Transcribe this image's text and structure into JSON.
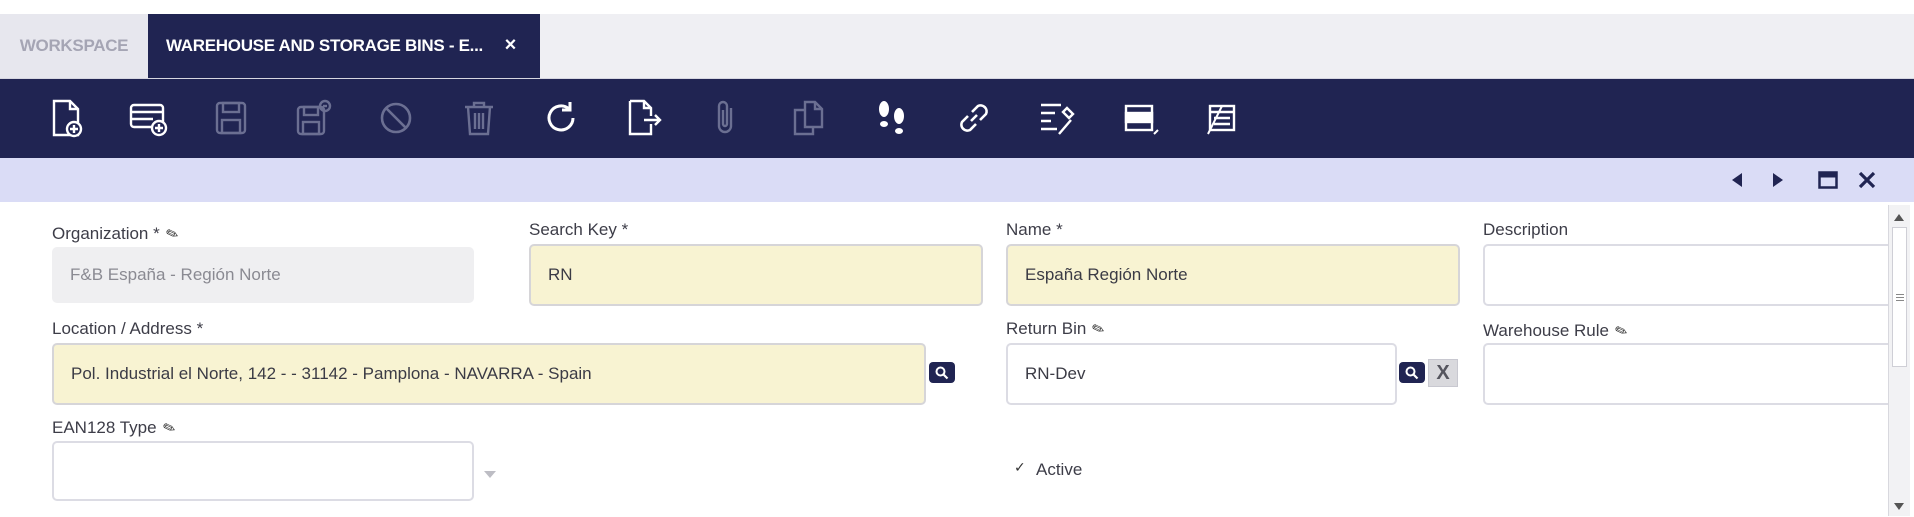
{
  "tabs": {
    "workspace": "WORKSPACE",
    "active": "WAREHOUSE AND STORAGE BINS - E...",
    "close_glyph": "×"
  },
  "toolbar": {
    "icons": [
      "new-document-icon",
      "new-row-icon",
      "save-icon",
      "save-close-icon",
      "undo-icon",
      "delete-icon",
      "refresh-icon",
      "export-icon",
      "attachment-icon",
      "copy-record-icon",
      "audit-trail-icon",
      "link-icon",
      "process-icon",
      "form-grid-toggle-icon",
      "notes-icon"
    ]
  },
  "nav": {
    "icons": [
      "previous-record-icon",
      "next-record-icon",
      "maximize-icon",
      "close-icon"
    ]
  },
  "form": {
    "organization": {
      "label": "Organization *",
      "value": "F&B España - Región Norte"
    },
    "search_key": {
      "label": "Search Key *",
      "value": "RN"
    },
    "name": {
      "label": "Name *",
      "value": "España Región Norte"
    },
    "description": {
      "label": "Description",
      "value": ""
    },
    "location": {
      "label": "Location / Address *",
      "value": "Pol. Industrial el Norte, 142 - - 31142 - Pamplona - NAVARRA - Spain"
    },
    "return_bin": {
      "label": "Return Bin",
      "value": "RN-Dev",
      "clear_glyph": "X"
    },
    "warehouse_rule": {
      "label": "Warehouse Rule",
      "value": ""
    },
    "ean128_type": {
      "label": "EAN128 Type",
      "value": ""
    },
    "active": {
      "label": "Active",
      "checked": true,
      "check_glyph": "✓"
    }
  },
  "colors": {
    "navy": "#202452",
    "nav_bar": "#dadcf6",
    "required_field": "#f8f3d2"
  }
}
